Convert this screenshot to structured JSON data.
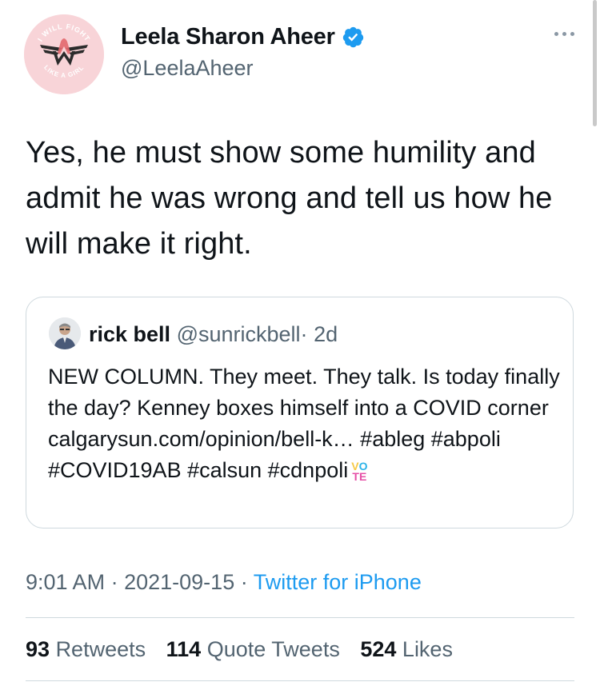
{
  "author": {
    "display_name": "Leela Sharon Aheer",
    "handle": "@LeelaAheer",
    "verified_icon": "verified-badge-icon",
    "avatar_text_top": "I WILL FIGHT",
    "avatar_text_bottom": "LIKE A GIRL",
    "avatar_color": "#f8d4d8"
  },
  "tweet": {
    "text": "Yes, he must show some humility and admit he was wrong and tell us how he will make it right."
  },
  "quote": {
    "name": "rick bell",
    "handle": "@sunrickbell",
    "separator": "·",
    "age": "2d",
    "text": "NEW COLUMN. They meet. They talk. Is today finally the day? Kenney boxes himself into a COVID corner calgarysun.com/opinion/bell-k… #ableg #abpoli #COVID19AB #calsun #cdnpoli",
    "emoji_top": "VO",
    "emoji_bottom": "TE"
  },
  "meta": {
    "time": "9:01 AM",
    "date": "2021-09-15",
    "separator": "·",
    "source": "Twitter for iPhone"
  },
  "stats": {
    "retweets_count": "93",
    "retweets_label": "Retweets",
    "quotes_count": "114",
    "quotes_label": "Quote Tweets",
    "likes_count": "524",
    "likes_label": "Likes"
  },
  "colors": {
    "accent": "#1d9bf0",
    "secondary_text": "#536471",
    "border": "#cfd9de"
  }
}
